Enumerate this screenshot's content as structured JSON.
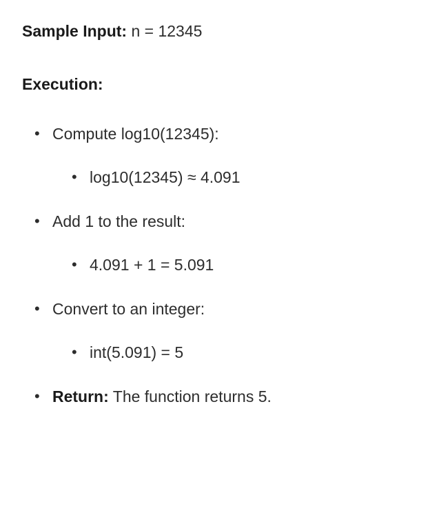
{
  "sample_input": {
    "label": "Sample Input:",
    "value": "n = 12345"
  },
  "execution_label": "Execution:",
  "steps": [
    {
      "text": "Compute log10(12345):",
      "sub": "log10(12345) ≈ 4.091"
    },
    {
      "text": "Add 1 to the result:",
      "sub": "4.091 + 1 = 5.091"
    },
    {
      "text": "Convert to an integer:",
      "sub": "int(5.091) = 5"
    }
  ],
  "return_step": {
    "label": "Return:",
    "text": "The function returns 5."
  }
}
